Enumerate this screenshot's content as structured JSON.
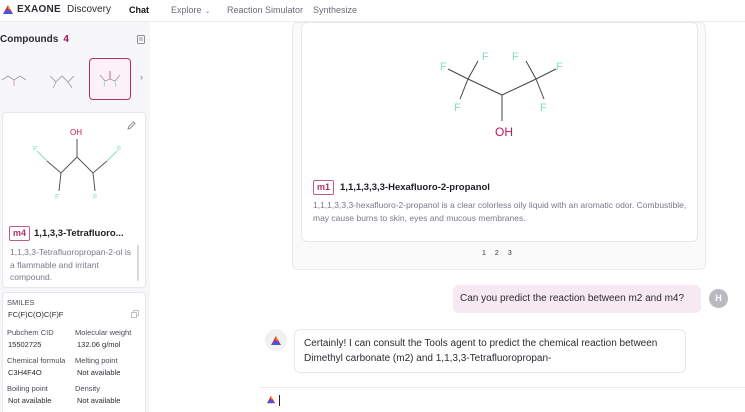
{
  "brand": {
    "name": "EXAONE",
    "sub": "Discovery"
  },
  "nav": [
    {
      "label": "Chat",
      "active": true
    },
    {
      "label": "Explore",
      "dropdown": true
    },
    {
      "label": "Reaction Simulator"
    },
    {
      "label": "Synthesize"
    }
  ],
  "compounds": {
    "heading": "Compounds",
    "count": "4",
    "selected": {
      "tag": "m4",
      "title": "1,1,3,3-Tetrafluoro...",
      "description": "1,1,3,3-Tetrafluoropropan-2-ol is a flammable and irritant compound.",
      "atom_labels": {
        "oh": "OH",
        "f": "F"
      }
    },
    "properties": {
      "smiles_label": "SMILES",
      "smiles_value": "FC(F)C(O)C(F)F",
      "pubchem_label": "Pubchem CID",
      "pubchem_value": "15502725",
      "mw_label": "Molecular weight",
      "mw_value": "132.06 g/mol",
      "formula_label": "Chemical formula",
      "formula_value": "C3H4F4O",
      "mp_label": "Melting point",
      "mp_value": "Not available",
      "bp_label": "Boiling point",
      "bp_value": "Not available",
      "density_label": "Density",
      "density_value": "Not available"
    }
  },
  "result": {
    "tag": "m1",
    "title": "1,1,1,3,3,3-Hexafluoro-2-propanol",
    "description": "1,1,1,3,3,3-hexafluoro-2-propanol is a clear colorless oily liquid with an aromatic odor. Combustible, may cause burns to skin, eyes and mucous membranes.",
    "atom_labels": {
      "oh": "OH",
      "f": "F"
    },
    "pages": [
      "1",
      "2",
      "3"
    ]
  },
  "chat": {
    "user_message": "Can you predict the reaction between m2 and m4?",
    "user_avatar": "H",
    "bot_message": "Certainly! I can consult the Tools agent to predict the chemical reaction between Dimethyl carbonate (m2) and 1,1,3,3-Tetrafluoropropan-",
    "input_value": ""
  },
  "colors": {
    "accent": "#b0316e",
    "bubble": "#f7e9f1",
    "oh": "#c0185a",
    "fluorine": "#7fe0c0"
  }
}
